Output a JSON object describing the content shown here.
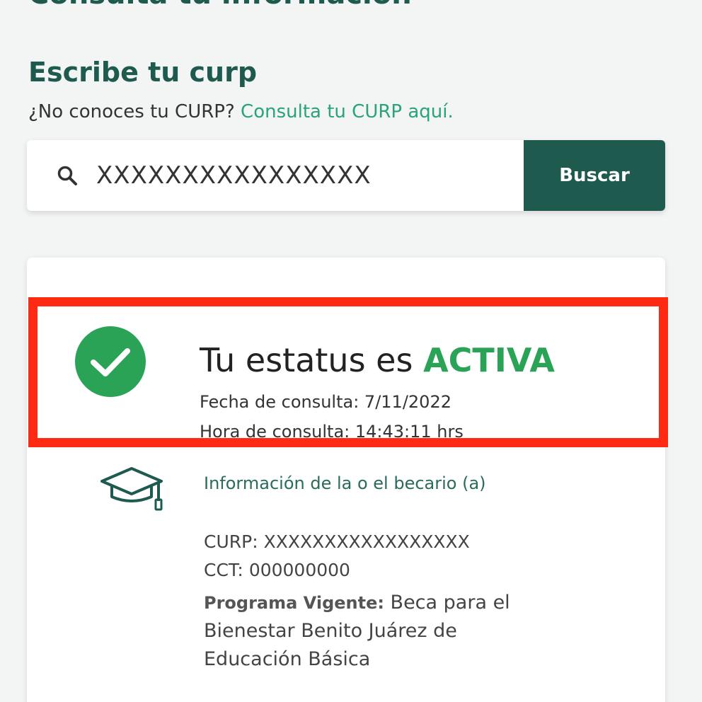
{
  "header": {
    "top_heading": "Consulta tu información",
    "section_title": "Escribe tu curp",
    "hint_text": "¿No conoces tu CURP?",
    "hint_link": "Consulta tu CURP aquí."
  },
  "search": {
    "value": "XXXXXXXXXXXXXXXX",
    "button_label": "Buscar",
    "icon": "search-icon"
  },
  "status": {
    "title_prefix": "Tu estatus es",
    "value": "ACTIVA",
    "date_label": "Fecha de consulta: 7/11/2022",
    "time_label": "Hora de consulta: 14:43:11 hrs",
    "icon": "check-circle-icon",
    "colors": {
      "success": "#2ba357",
      "highlight": "#ff2a12"
    }
  },
  "info": {
    "icon": "graduation-cap-icon",
    "title": "Información de la o el becario (a)",
    "curp_label": "CURP:",
    "curp_value": "XXXXXXXXXXXXXXXXX",
    "cct_label": "CCT:",
    "cct_value": "000000000",
    "program_label": "Programa Vigente:",
    "program_value": "Beca para el Bienestar Benito Juárez de Educación Básica"
  },
  "colors": {
    "brand": "#1e5a4e",
    "link": "#2ba37a"
  }
}
